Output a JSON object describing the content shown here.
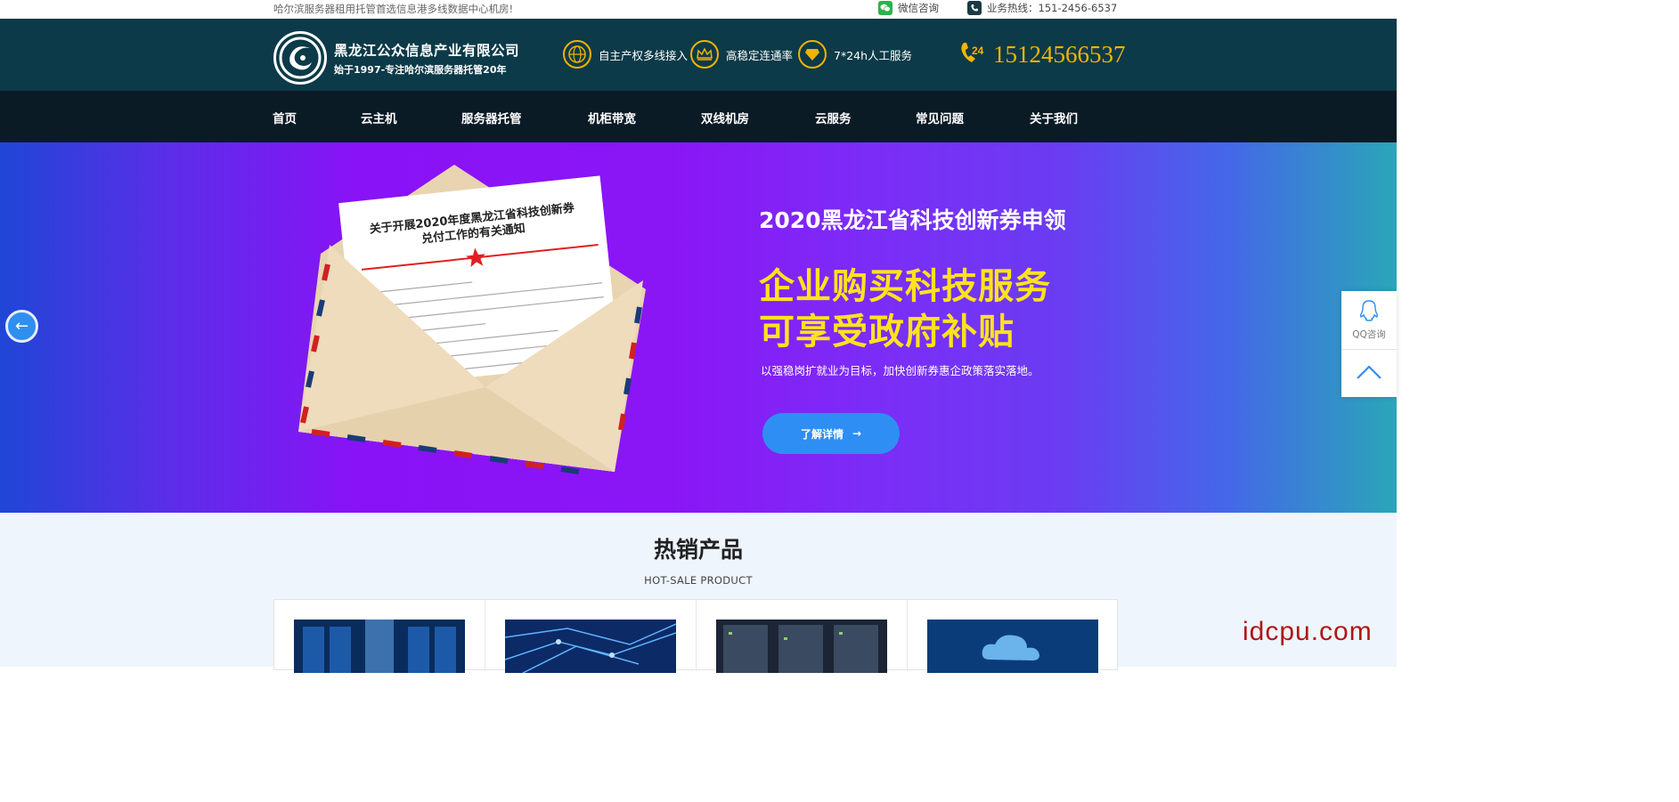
{
  "topbar": {
    "slogan": "哈尔滨服务器租用托管首选信息港多线数据中心机房!",
    "wechat": "微信咨询",
    "hotline": "业务热线：151-2456-6537"
  },
  "header": {
    "company": "黑龙江公众信息产业有限公司",
    "tagline": "始于1997-专注哈尔滨服务器托管20年",
    "features": [
      "自主产权多线接入",
      "高稳定连通率",
      "7*24h人工服务"
    ],
    "phone_badge": "24",
    "phone": "15124566537"
  },
  "nav": {
    "items": [
      "首页",
      "云主机",
      "服务器托管",
      "机柜带宽",
      "双线机房",
      "云服务",
      "常见问题",
      "关于我们"
    ]
  },
  "banner": {
    "letter_title_1": "关于开展2020年度黑龙江省科技创新券",
    "letter_title_2": "兑付工作的有关通知",
    "heading": "2020黑龙江省科技创新券申领",
    "big_line1": "企业购买科技服务",
    "big_line2": "可享受政府补贴",
    "desc": "以强稳岗扩就业为目标，加快创新券惠企政策落实落地。",
    "button": "了解详情",
    "button_arrow": "→",
    "prev_arrow": "←"
  },
  "side": {
    "qq_label": "QQ咨询"
  },
  "hot": {
    "title": "热销产品",
    "subtitle": "HOT-SALE PRODUCT"
  },
  "watermark": "idcpu.com",
  "colors": {
    "header_bg": "#0c3a48",
    "nav_bg": "#0b1b26",
    "accent_gold": "#f5b400",
    "banner_yellow": "#ffe21f",
    "button_blue": "#2f8ef3"
  }
}
